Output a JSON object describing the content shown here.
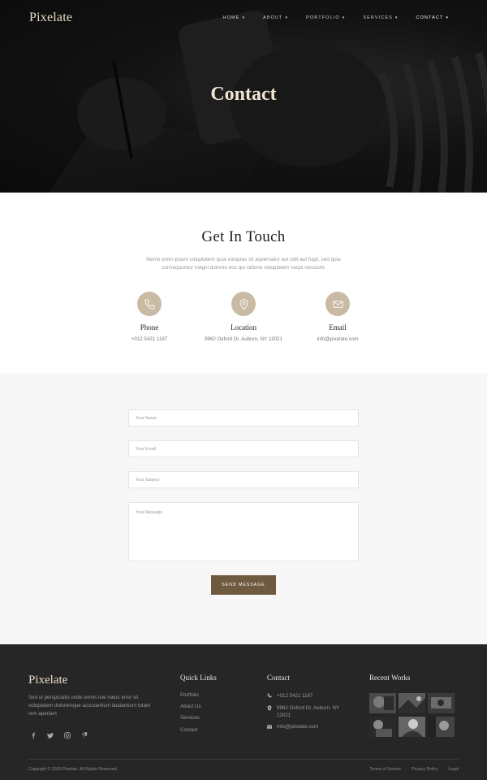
{
  "nav": {
    "logo": "Pixelate",
    "items": [
      {
        "label": "HOME",
        "caret": "▾"
      },
      {
        "label": "ABOUT",
        "caret": "▾"
      },
      {
        "label": "PORTFOLIO",
        "caret": "▾"
      },
      {
        "label": "SERVICES",
        "caret": "▾"
      },
      {
        "label": "CONTACT",
        "caret": "▾"
      }
    ],
    "active": "CONTACT"
  },
  "hero": {
    "title": "Contact"
  },
  "touch": {
    "title": "Get In Touch",
    "lead": "Nemo enim ipsam voluptatem quia voluptas sit aspernatur aut odit aut fugit, sed quia consequuntur magni dolores eos qui ratione voluptatem sequi nesciunt.",
    "items": [
      {
        "icon": "phone-icon",
        "title": "Phone",
        "value": "+012 5421 1187"
      },
      {
        "icon": "location-pin-icon",
        "title": "Location",
        "value": "9962 Oxford Dr. Auburn, NY 13021"
      },
      {
        "icon": "envelope-icon",
        "title": "Email",
        "value": "info@pixelate.com"
      }
    ]
  },
  "form": {
    "name_placeholder": "Your Name",
    "email_placeholder": "Your Email",
    "subject_placeholder": "Your Subject",
    "message_placeholder": "Your Message",
    "submit_label": "SEND MESSAGE"
  },
  "footer": {
    "logo": "Pixelate",
    "description": "Sed ut perspiciatis unde omnis iste natus error sit voluptatem doloremque accusantium laudantium totam rem aperiam",
    "socials": [
      "facebook-icon",
      "twitter-icon",
      "instagram-icon",
      "pinterest-icon"
    ],
    "quick_links_title": "Quick Links",
    "quick_links": [
      "Portfolio",
      "About Us",
      "Services",
      "Contact"
    ],
    "contact_title": "Contact",
    "contact_phone": "+012 5421 1187",
    "contact_address": "9962 Oxford Dr. Auburn, NY 13021",
    "contact_email": "info@pixelate.com",
    "recent_title": "Recent Works",
    "copyright": "Copyright © 2020 Pixelate. All Rights Reserved.",
    "legal": [
      "Terms of Service",
      "Privacy Policy",
      "Legal"
    ]
  },
  "colors": {
    "accent_beige": "#c9bba3",
    "button_brown": "#6f5a40",
    "footer_bg": "#262626",
    "logo_cream": "#e8dcc6"
  }
}
